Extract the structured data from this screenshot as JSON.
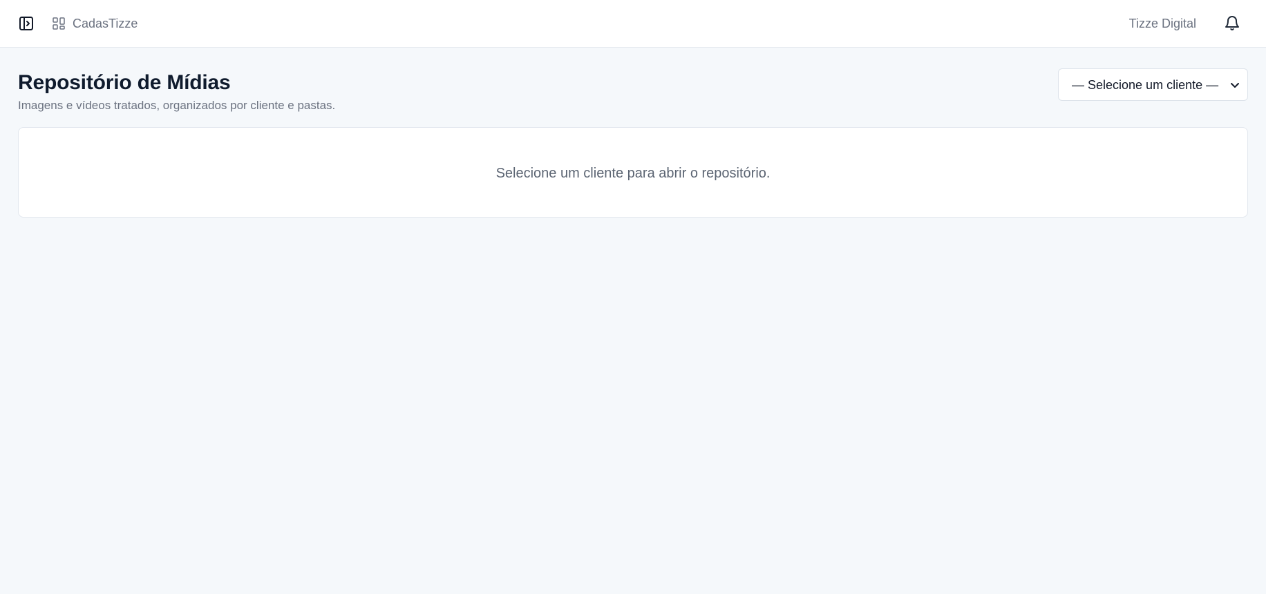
{
  "header": {
    "app_name": "CadasTizze",
    "org_name": "Tizze Digital",
    "icons": {
      "sidebar_toggle": "sidebar-toggle-icon",
      "app": "grid-icon",
      "notifications": "bell-icon"
    }
  },
  "page": {
    "title": "Repositório de Mídias",
    "subtitle": "Imagens e vídeos tratados, organizados por cliente e pastas."
  },
  "client_select": {
    "selected": "— Selecione um cliente —"
  },
  "repository": {
    "empty_message": "Selecione um cliente para abrir o repositório."
  },
  "colors": {
    "background": "#f5f8fb",
    "surface": "#ffffff",
    "border": "#e2e7ee",
    "title": "#0f1b2d",
    "muted": "#6b7280"
  }
}
